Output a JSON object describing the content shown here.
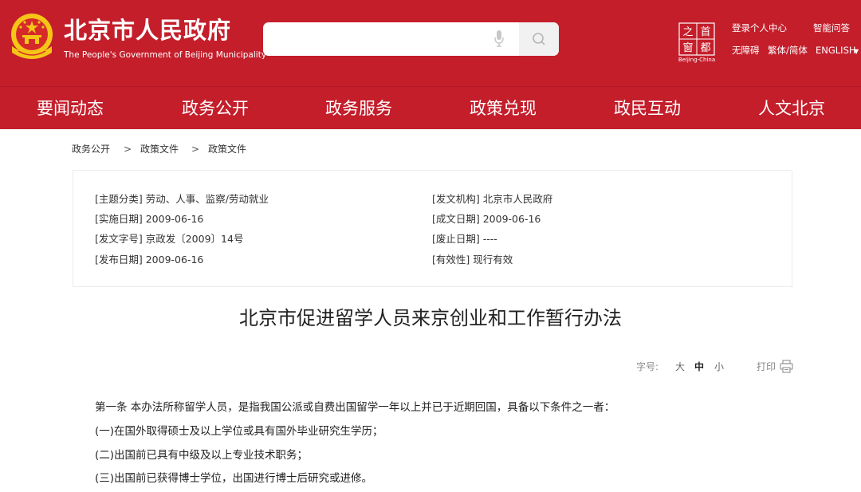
{
  "header": {
    "title": "北京市人民政府",
    "subtitle": "The People's Government of Beijing Municipality",
    "search": {
      "value": "",
      "placeholder": ""
    },
    "capital_logo": {
      "glyphs": [
        "之",
        "首",
        "窗",
        "都"
      ],
      "label": "Beijing-China"
    },
    "top_links": {
      "login": "登录个人中心",
      "qa": "智能问答",
      "accessibility": "无障碍",
      "traditional": "繁体/简体",
      "english": "ENGLISH"
    },
    "icons": {
      "emblem": "national-emblem-icon",
      "mic": "microphone-icon",
      "search": "search-icon",
      "lang": "caret-down-icon"
    },
    "colors": {
      "brand_red": "#c41e2b",
      "emblem_gold": "#f5c518"
    }
  },
  "nav": {
    "items": [
      "要闻动态",
      "政务公开",
      "政务服务",
      "政策兑现",
      "政民互动",
      "人文北京"
    ]
  },
  "breadcrumb": {
    "items": [
      "政务公开",
      "政策文件",
      "政策文件"
    ],
    "separator": ">"
  },
  "meta": {
    "topic": "[主题分类] 劳动、人事、监察/劳动就业",
    "effective_date": "[实施日期] 2009-06-16",
    "doc_number": "[发文字号] 京政发〔2009〕14号",
    "publish_date": "[发布日期] 2009-06-16",
    "issuer": "[发文机构] 北京市人民政府",
    "written_date": "[成文日期] 2009-06-16",
    "repeal_date": "[废止日期] ----",
    "validity": "[有效性] 现行有效"
  },
  "document": {
    "title": "北京市促进留学人员来京创业和工作暂行办法",
    "font_label": "字号:",
    "font_sizes": {
      "large": "大",
      "medium": "中",
      "small": "小"
    },
    "print_label": "打印",
    "paragraphs": [
      "第一条   本办法所称留学人员，是指我国公派或自费出国留学一年以上并已于近期回国，具备以下条件之一者：",
      "(一)在国外取得硕士及以上学位或具有国外毕业研究生学历；",
      "(二)出国前已具有中级及以上专业技术职务；",
      "(三)出国前已获得博士学位，出国进行博士后研究或进修。"
    ],
    "icons": {
      "print": "printer-icon"
    }
  }
}
